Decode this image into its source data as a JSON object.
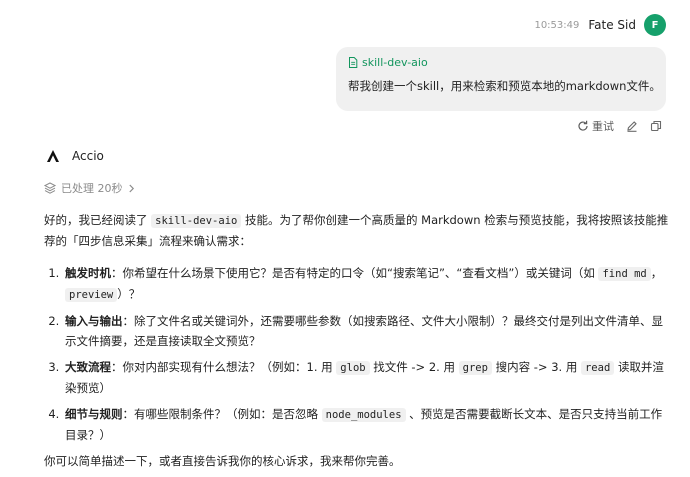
{
  "header": {
    "time": "10:53:49",
    "user_name": "Fate Sid",
    "avatar_initial": "F"
  },
  "user_message": {
    "skill_tag": "skill-dev-aio",
    "text": "帮我创建一个skill，用来检索和预览本地的markdown文件。"
  },
  "message_actions": {
    "retry_label": "重试",
    "edit_icon": "pencil-icon",
    "copy_icon": "copy-icon"
  },
  "agent": {
    "name": "Accio",
    "processed_label": "已处理 20秒"
  },
  "answer": {
    "intro_pre": "好的，我已经阅读了",
    "intro_code": "skill-dev-aio",
    "intro_post": "技能。为了帮你创建一个高质量的 Markdown 检索与预览技能，我将按照该技能推荐的「四步信息采集」流程来确认需求：",
    "items": [
      {
        "title": "触发时机",
        "t1": "：你希望在什么场景下使用它？是否有特定的口令（如“搜索笔记”、“查看文档”）或关键词（如",
        "c1": "find md",
        "t2": "，",
        "c2": "preview",
        "t3": "）？"
      },
      {
        "title": "输入与输出",
        "t1": "：除了文件名或关键词外，还需要哪些参数（如搜索路径、文件大小限制）？最终交付是列出文件清单、显示文件摘要，还是直接读取全文预览？"
      },
      {
        "title": "大致流程",
        "t1": "：你对内部实现有什么想法？（例如：1. 用",
        "c1": "glob",
        "t2": "找文件 -> 2. 用",
        "c2": "grep",
        "t3": "搜内容 -> 3. 用",
        "c3": "read",
        "t4": "读取并渲染预览）"
      },
      {
        "title": "细节与规则",
        "t1": "：有哪些限制条件？（例如：是否忽略",
        "c1": "node_modules",
        "t2": "、预览是否需要截断长文本、是否只支持当前工作目录？）"
      }
    ],
    "closing": "你可以简单描述一下，或者直接告诉我你的核心诉求，我来帮你完善。"
  },
  "colors": {
    "avatar_bg": "#16a06b",
    "skill_tag": "#12955d",
    "bubble_bg": "#f0f0f0",
    "muted_text": "#8b8b8b"
  }
}
